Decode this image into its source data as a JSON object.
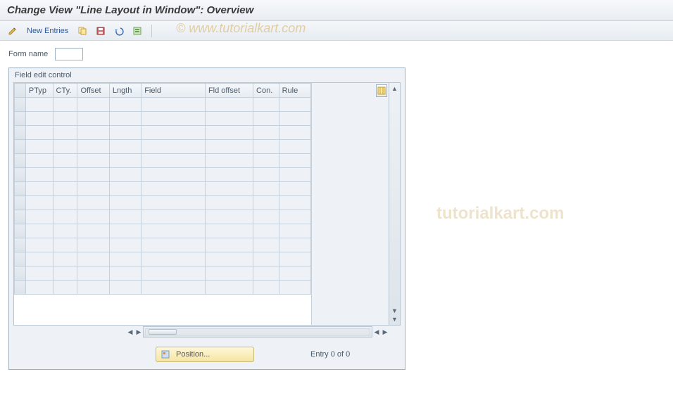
{
  "title": "Change View \"Line Layout in Window\": Overview",
  "watermark1": "©  www.tutorialkart.com",
  "watermark2": "tutorialkart.com",
  "toolbar": {
    "new_entries_label": "New Entries"
  },
  "form": {
    "form_name_label": "Form name",
    "form_name_value": ""
  },
  "panel": {
    "title": "Field edit control"
  },
  "columns": {
    "sel": "",
    "ptyp": "PTyp",
    "cty": "CTy.",
    "offset": "Offset",
    "lngth": "Lngth",
    "field": "Field",
    "fld_offset": "Fld offset",
    "con": "Con.",
    "rule": "Rule"
  },
  "footer": {
    "position_label": "Position...",
    "entry_text": "Entry 0 of 0"
  }
}
